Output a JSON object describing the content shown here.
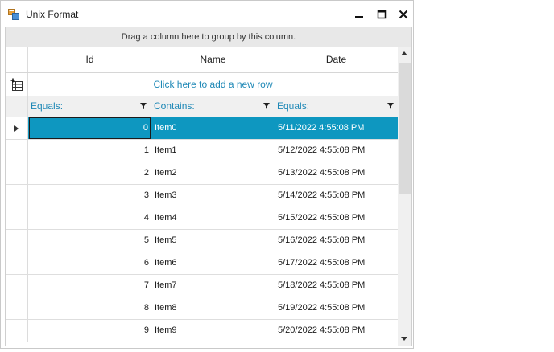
{
  "window": {
    "title": "Unix Format",
    "icon": "winforms-app-icon"
  },
  "grid": {
    "group_panel_text": "Drag a column here to group by this column.",
    "columns": [
      {
        "header": "Id",
        "filter_label": "Equals:"
      },
      {
        "header": "Name",
        "filter_label": "Contains:"
      },
      {
        "header": "Date",
        "filter_label": "Equals:"
      }
    ],
    "new_row_text": "Click here to add a new row",
    "selected_row_index": 0,
    "rows": [
      {
        "id": "0",
        "name": "Item0",
        "date": "5/11/2022 4:55:08 PM"
      },
      {
        "id": "1",
        "name": "Item1",
        "date": "5/12/2022 4:55:08 PM"
      },
      {
        "id": "2",
        "name": "Item2",
        "date": "5/13/2022 4:55:08 PM"
      },
      {
        "id": "3",
        "name": "Item3",
        "date": "5/14/2022 4:55:08 PM"
      },
      {
        "id": "4",
        "name": "Item4",
        "date": "5/15/2022 4:55:08 PM"
      },
      {
        "id": "5",
        "name": "Item5",
        "date": "5/16/2022 4:55:08 PM"
      },
      {
        "id": "6",
        "name": "Item6",
        "date": "5/17/2022 4:55:08 PM"
      },
      {
        "id": "7",
        "name": "Item7",
        "date": "5/18/2022 4:55:08 PM"
      },
      {
        "id": "8",
        "name": "Item8",
        "date": "5/19/2022 4:55:08 PM"
      },
      {
        "id": "9",
        "name": "Item9",
        "date": "5/20/2022 4:55:08 PM"
      }
    ]
  },
  "colors": {
    "accent": "#0e97c0",
    "link": "#1e88b6"
  }
}
